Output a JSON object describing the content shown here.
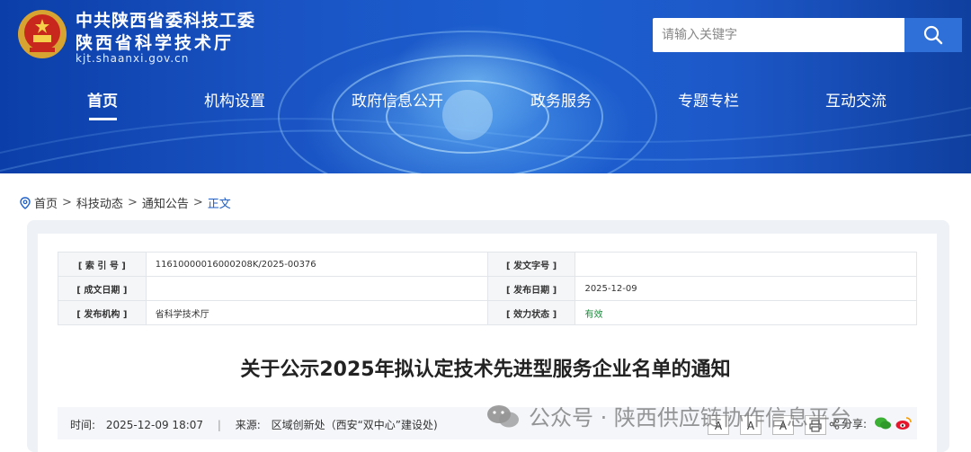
{
  "header": {
    "org_line1": "中共陕西省委科技工委",
    "org_line2": "陕西省科学技术厅",
    "domain": "kjt.shaanxi.gov.cn",
    "search_placeholder": "请输入关键字"
  },
  "nav": {
    "items": [
      "首页",
      "机构设置",
      "政府信息公开",
      "政务服务",
      "专题专栏",
      "互动交流"
    ],
    "active_index": 0
  },
  "breadcrumb": {
    "items": [
      "首页",
      "科技动态",
      "通知公告",
      "正文"
    ],
    "separator": ">"
  },
  "meta": {
    "rows": [
      {
        "k1": "[ 索 引 号 ]",
        "v1": "11610000016000208K/2025-00376",
        "k2": "[ 发文字号 ]",
        "v2": ""
      },
      {
        "k1": "[ 成文日期 ]",
        "v1": "",
        "k2": "[ 发布日期 ]",
        "v2": "2025-12-09"
      },
      {
        "k1": "[ 发布机构 ]",
        "v1": "省科学技术厅",
        "k2": "[ 效力状态 ]",
        "v2": "有效"
      }
    ]
  },
  "article": {
    "title": "关于公示2025年拟认定技术先进型服务企业名单的通知",
    "time_label": "时间:",
    "time_value": "2025-12-09 18:07",
    "source_label": "来源:",
    "source_value": "区域创新处（西安“双中心”建设处)"
  },
  "tools": {
    "font_sizes": [
      "A",
      "A",
      "A"
    ],
    "share_label": "分享:"
  },
  "watermark": "公众号 · 陕西供应链协作信息平台",
  "colors": {
    "header_blue": "#1a54c4",
    "link_blue": "#1f5fc9",
    "valid_green": "#1a8a3a"
  }
}
